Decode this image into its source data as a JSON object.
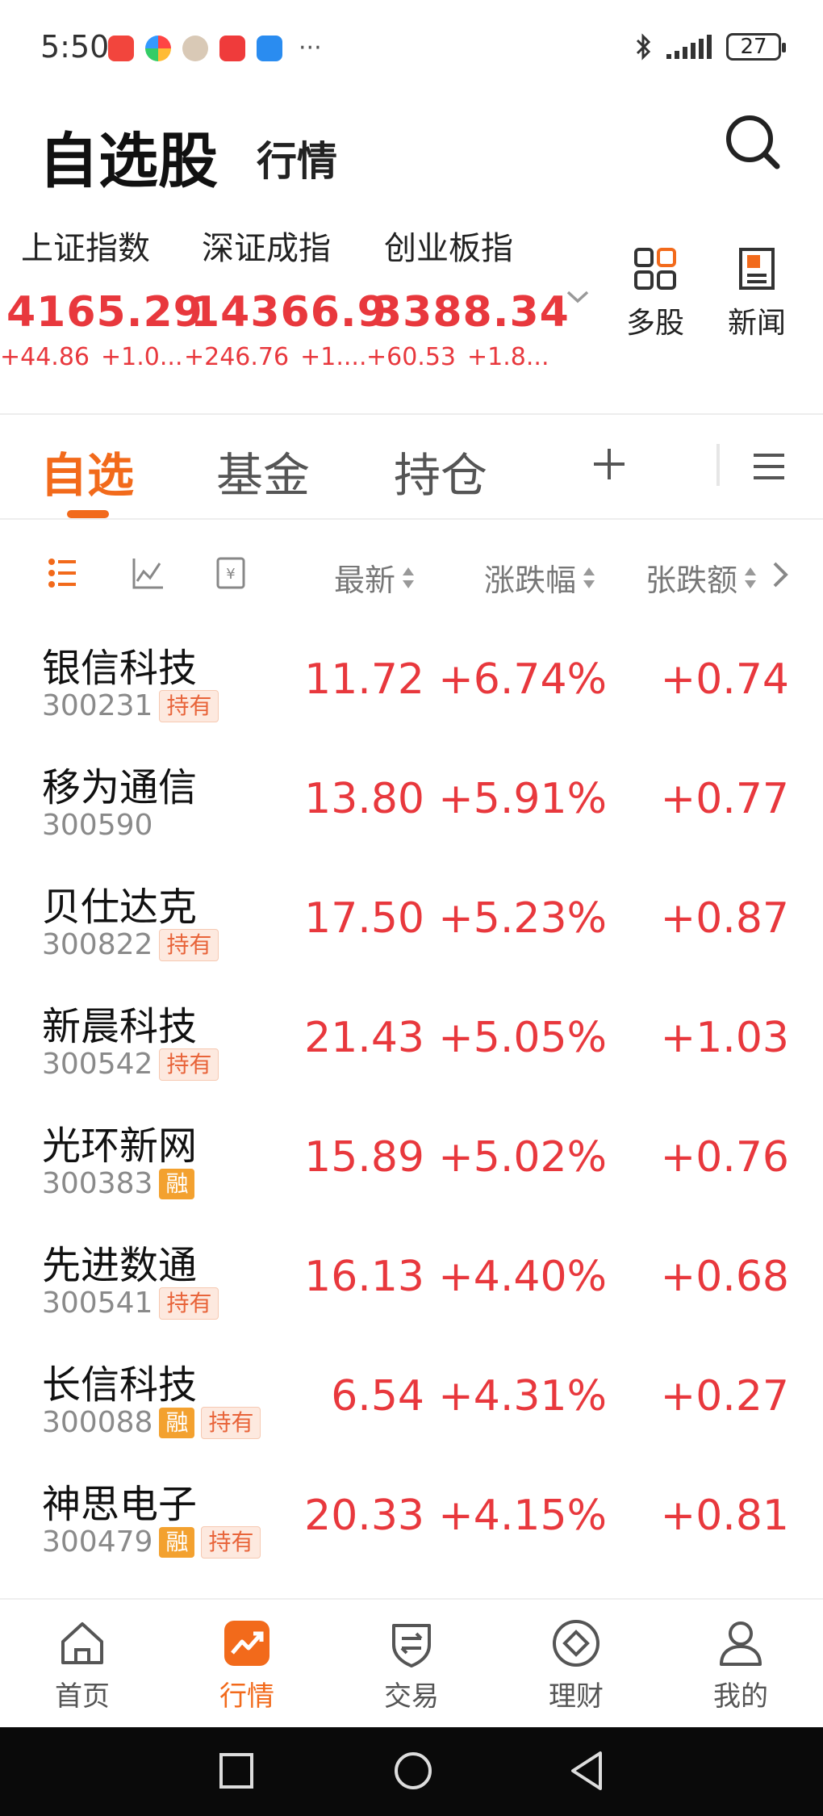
{
  "status_bar": {
    "time": "5:50",
    "battery": "27"
  },
  "header": {
    "title": "自选股",
    "subtitle": "行情"
  },
  "indices": [
    {
      "name": "上证指数",
      "value": "4165.29",
      "change": "+44.86",
      "change_pct": "+1.0..."
    },
    {
      "name": "深证成指",
      "value": "14366.9",
      "change": "+246.76",
      "change_pct": "+1...."
    },
    {
      "name": "创业板指",
      "value": "3388.34",
      "change": "+60.53",
      "change_pct": "+1.8..."
    }
  ],
  "quick_actions": [
    {
      "label": "多股",
      "icon": "grid-icon"
    },
    {
      "label": "新闻",
      "icon": "news-icon"
    }
  ],
  "tabs": [
    {
      "label": "自选",
      "active": true
    },
    {
      "label": "基金",
      "active": false
    },
    {
      "label": "持仓",
      "active": false
    }
  ],
  "columns": {
    "latest": "最新",
    "change_pct": "涨跌幅",
    "change_amt": "张跌额"
  },
  "stocks": [
    {
      "name": "银信科技",
      "code": "300231",
      "badges": [
        "持有"
      ],
      "price": "11.72",
      "pct": "+6.74%",
      "amt": "+0.74"
    },
    {
      "name": "移为通信",
      "code": "300590",
      "badges": [],
      "price": "13.80",
      "pct": "+5.91%",
      "amt": "+0.77"
    },
    {
      "name": "贝仕达克",
      "code": "300822",
      "badges": [
        "持有"
      ],
      "price": "17.50",
      "pct": "+5.23%",
      "amt": "+0.87"
    },
    {
      "name": "新晨科技",
      "code": "300542",
      "badges": [
        "持有"
      ],
      "price": "21.43",
      "pct": "+5.05%",
      "amt": "+1.03"
    },
    {
      "name": "光环新网",
      "code": "300383",
      "badges": [
        "融"
      ],
      "price": "15.89",
      "pct": "+5.02%",
      "amt": "+0.76"
    },
    {
      "name": "先进数通",
      "code": "300541",
      "badges": [
        "持有"
      ],
      "price": "16.13",
      "pct": "+4.40%",
      "amt": "+0.68"
    },
    {
      "name": "长信科技",
      "code": "300088",
      "badges": [
        "融",
        "持有"
      ],
      "price": "6.54",
      "pct": "+4.31%",
      "amt": "+0.27"
    },
    {
      "name": "神思电子",
      "code": "300479",
      "badges": [
        "融",
        "持有"
      ],
      "price": "20.33",
      "pct": "+4.15%",
      "amt": "+0.81"
    }
  ],
  "bottom_nav": [
    {
      "label": "首页",
      "icon": "home-icon",
      "active": false
    },
    {
      "label": "行情",
      "icon": "market-icon",
      "active": true
    },
    {
      "label": "交易",
      "icon": "trade-icon",
      "active": false
    },
    {
      "label": "理财",
      "icon": "wealth-icon",
      "active": false
    },
    {
      "label": "我的",
      "icon": "profile-icon",
      "active": false
    }
  ],
  "colors": {
    "accent": "#f26a1b",
    "up": "#e8383d",
    "hold_badge": "#e8643a",
    "margin_badge": "#f3a12f"
  }
}
